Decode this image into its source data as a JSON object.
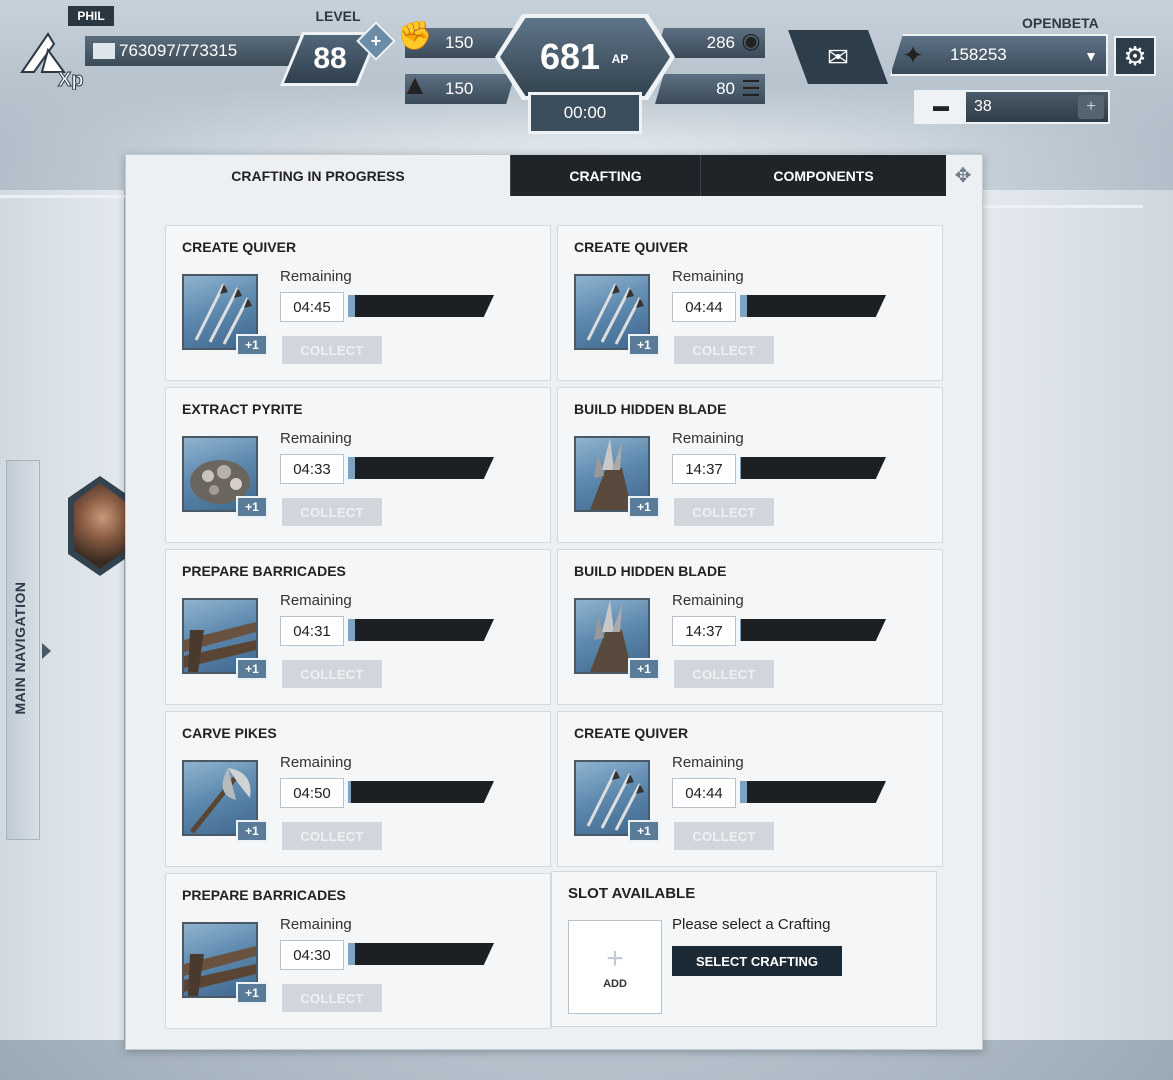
{
  "player": {
    "name": "PHIL",
    "xp_text": "763097/773315",
    "level_label": "LEVEL",
    "level": "88",
    "level_plus": "+"
  },
  "stats": {
    "left_top": "150",
    "left_bottom": "150",
    "ap": "681",
    "ap_icon": "AP",
    "right_top": "286",
    "right_bottom": "80",
    "timer": "00:00"
  },
  "currency": {
    "server": "OPENBETA",
    "amount": "158253",
    "tickets": "38",
    "ticket_plus": "+"
  },
  "nav": {
    "main_navigation": "MAIN NAVIGATION"
  },
  "tabs": [
    {
      "label": "CRAFTING IN PROGRESS"
    },
    {
      "label": "CRAFTING"
    },
    {
      "label": "COMPONENTS"
    }
  ],
  "remaining_label": "Remaining",
  "collect_label": "COLLECT",
  "plus_one": "+1",
  "cards": [
    {
      "title": "CREATE QUIVER",
      "time": "04:45",
      "progress": 0.05,
      "icon": "quiver-icon"
    },
    {
      "title": "CREATE QUIVER",
      "time": "04:44",
      "progress": 0.05,
      "icon": "quiver-icon"
    },
    {
      "title": "EXTRACT PYRITE",
      "time": "04:33",
      "progress": 0.05,
      "icon": "pyrite-icon"
    },
    {
      "title": "BUILD HIDDEN BLADE",
      "time": "14:37",
      "progress": 0.01,
      "icon": "hidden-blade-icon"
    },
    {
      "title": "PREPARE BARRICADES",
      "time": "04:31",
      "progress": 0.05,
      "icon": "barricade-icon"
    },
    {
      "title": "BUILD HIDDEN BLADE",
      "time": "14:37",
      "progress": 0.01,
      "icon": "hidden-blade-icon"
    },
    {
      "title": "CARVE PIKES",
      "time": "04:50",
      "progress": 0.02,
      "icon": "pike-icon"
    },
    {
      "title": "CREATE QUIVER",
      "time": "04:44",
      "progress": 0.05,
      "icon": "quiver-icon"
    },
    {
      "title": "PREPARE BARRICADES",
      "time": "04:30",
      "progress": 0.05,
      "icon": "barricade-icon"
    }
  ],
  "slot": {
    "title": "SLOT AVAILABLE",
    "add_plus": "+",
    "add_label": "ADD",
    "hint": "Please select a Crafting",
    "button": "SELECT CRAFTING"
  }
}
